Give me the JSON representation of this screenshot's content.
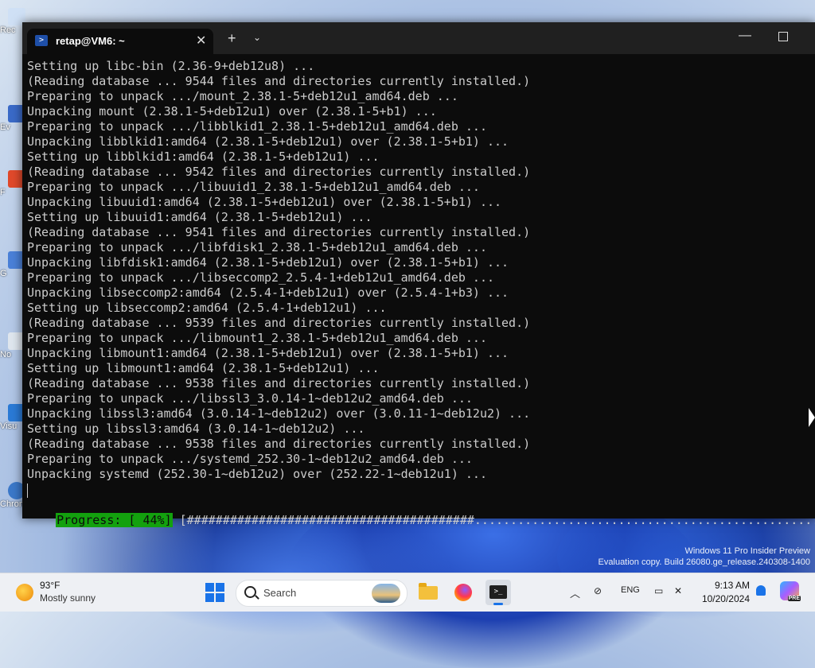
{
  "desktop": {
    "icons": [
      "Rec",
      "Ev",
      "F",
      "G",
      "No",
      "Visu",
      "Chromium"
    ]
  },
  "terminal": {
    "tab_title": "retap@VM6: ~",
    "lines": [
      "Setting up libc-bin (2.36-9+deb12u8) ...",
      "(Reading database ... 9544 files and directories currently installed.)",
      "Preparing to unpack .../mount_2.38.1-5+deb12u1_amd64.deb ...",
      "Unpacking mount (2.38.1-5+deb12u1) over (2.38.1-5+b1) ...",
      "Preparing to unpack .../libblkid1_2.38.1-5+deb12u1_amd64.deb ...",
      "Unpacking libblkid1:amd64 (2.38.1-5+deb12u1) over (2.38.1-5+b1) ...",
      "Setting up libblkid1:amd64 (2.38.1-5+deb12u1) ...",
      "(Reading database ... 9542 files and directories currently installed.)",
      "Preparing to unpack .../libuuid1_2.38.1-5+deb12u1_amd64.deb ...",
      "Unpacking libuuid1:amd64 (2.38.1-5+deb12u1) over (2.38.1-5+b1) ...",
      "Setting up libuuid1:amd64 (2.38.1-5+deb12u1) ...",
      "(Reading database ... 9541 files and directories currently installed.)",
      "Preparing to unpack .../libfdisk1_2.38.1-5+deb12u1_amd64.deb ...",
      "Unpacking libfdisk1:amd64 (2.38.1-5+deb12u1) over (2.38.1-5+b1) ...",
      "Preparing to unpack .../libseccomp2_2.5.4-1+deb12u1_amd64.deb ...",
      "Unpacking libseccomp2:amd64 (2.5.4-1+deb12u1) over (2.5.4-1+b3) ...",
      "Setting up libseccomp2:amd64 (2.5.4-1+deb12u1) ...",
      "(Reading database ... 9539 files and directories currently installed.)",
      "Preparing to unpack .../libmount1_2.38.1-5+deb12u1_amd64.deb ...",
      "Unpacking libmount1:amd64 (2.38.1-5+deb12u1) over (2.38.1-5+b1) ...",
      "Setting up libmount1:amd64 (2.38.1-5+deb12u1) ...",
      "(Reading database ... 9538 files and directories currently installed.)",
      "Preparing to unpack .../libssl3_3.0.14-1~deb12u2_amd64.deb ...",
      "Unpacking libssl3:amd64 (3.0.14-1~deb12u2) over (3.0.11-1~deb12u2) ...",
      "Setting up libssl3:amd64 (3.0.14-1~deb12u2) ...",
      "(Reading database ... 9538 files and directories currently installed.)",
      "Preparing to unpack .../systemd_252.30-1~deb12u2_amd64.deb ...",
      "Unpacking systemd (252.30-1~deb12u2) over (252.22-1~deb12u1) ..."
    ],
    "progress_label": "Progress: [ 44%]",
    "progress_bar": "[########################################.................................................]",
    "progress_percent": 44
  },
  "watermark": {
    "line1": "Windows 11 Pro Insider Preview",
    "line2": "Evaluation copy. Build 26080.ge_release.240308-1400"
  },
  "taskbar": {
    "weather_temp": "93°F",
    "weather_desc": "Mostly sunny",
    "search_placeholder": "Search",
    "terminal_app_glyph": ">_",
    "language": "ENG",
    "time": "9:13 AM",
    "date": "10/20/2024",
    "copilot_badge": "PRE"
  },
  "colors": {
    "progress_green": "#13a10e",
    "console_bg": "#0c0c0c",
    "console_fg": "#cccccc",
    "accent": "#1a73e8"
  }
}
